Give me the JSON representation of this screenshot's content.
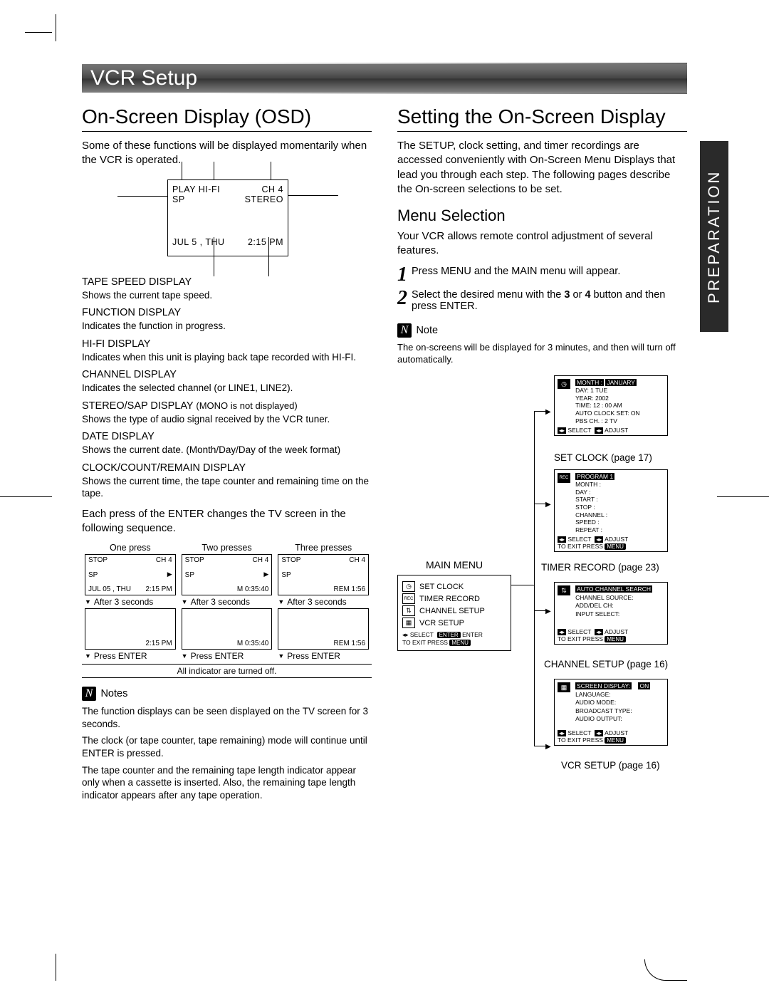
{
  "title": "VCR Setup",
  "side_tab": "PREPARATION",
  "left": {
    "section": "On-Screen Display (OSD)",
    "intro": "Some of these functions will be displayed momentarily when the VCR is operated.",
    "osd": {
      "l1_left": "PLAY HI-FI",
      "l1_right": "CH  4",
      "l2_left": "SP",
      "l2_right": "STEREO",
      "l3_left": "JUL   5 , THU",
      "l3_right": "2:15 PM"
    },
    "defs": [
      {
        "h": "TAPE SPEED DISPLAY",
        "p": "Shows the current tape speed."
      },
      {
        "h": "FUNCTION DISPLAY",
        "p": "Indicates the function in progress."
      },
      {
        "h": "HI-FI DISPLAY",
        "p": "Indicates when this unit is playing back tape recorded with HI-FI."
      },
      {
        "h": "CHANNEL DISPLAY",
        "p": "Indicates the selected channel (or LINE1, LINE2)."
      },
      {
        "h": "STEREO/SAP DISPLAY",
        "extra": "(MONO is not displayed)",
        "p": "Shows the type of audio signal received by the VCR tuner."
      },
      {
        "h": "DATE DISPLAY",
        "p": "Shows the current date. (Month/Day/Day of the week format)"
      },
      {
        "h": "CLOCK/COUNT/REMAIN DISPLAY",
        "p": "Shows the current time, the tape counter and remaining time on the tape."
      }
    ],
    "seq_intro": "Each press of the ENTER changes the TV screen in the following sequence.",
    "presses": [
      "One press",
      "Two presses",
      "Three presses"
    ],
    "tiny1": {
      "a": "STOP",
      "b": "CH   4",
      "c": "SP",
      "d": "JUL   05 , THU",
      "e": "2:15 PM",
      "f": "2:15 PM"
    },
    "tiny2": {
      "a": "STOP",
      "b": "CH   4",
      "c": "SP",
      "d": "",
      "e": "M 0:35:40",
      "f": "M 0:35:40"
    },
    "tiny3": {
      "a": "STOP",
      "b": "CH   4",
      "c": "SP",
      "d": "",
      "e": "REM 1:56",
      "f": "REM 1:56"
    },
    "after3": "After 3 seconds",
    "press_enter": "Press ENTER",
    "all_off": "All indicator are turned off.",
    "notes_label": "Notes",
    "notes": [
      "The function displays can be seen displayed on the TV screen for 3 seconds.",
      "The clock (or tape counter, tape remaining) mode will continue until ENTER is pressed.",
      "The tape counter and the remaining tape length indicator appear only when a cassette is inserted. Also, the remaining tape length indicator appears after any tape operation."
    ]
  },
  "right": {
    "section": "Setting the On-Screen Display",
    "intro": "The SETUP, clock setting, and timer recordings are accessed conveniently with On-Screen Menu Displays that lead you through each step. The following pages describe the On-screen selections to be set.",
    "subsection": "Menu Selection",
    "sub_intro": "Your VCR allows remote control adjustment of several features.",
    "step1": "Press MENU and the MAIN menu will appear.",
    "step2a": "Select the desired menu with the ",
    "step2b": "3",
    "step2c": " or ",
    "step2d": "4",
    "step2e": " button and then press ENTER.",
    "note_label": "Note",
    "note": "The on-screens will be displayed for 3 minutes, and then will turn off automatically.",
    "main_menu_label": "MAIN MENU",
    "main_items": [
      "SET  CLOCK",
      "TIMER RECORD",
      "CHANNEL  SETUP",
      "VCR SETUP"
    ],
    "mm_footer_select": "SELECT",
    "mm_footer_enter": "ENTER",
    "mm_footer_exit": "TO  EXIT   PRESS",
    "mm_footer_menu": "MENU",
    "sel_adj": {
      "select": "SELECT",
      "adjust": "ADJUST",
      "exit": "TO  EXIT   PRESS",
      "menu": "MENU"
    },
    "blocks": {
      "clock": {
        "rows": [
          [
            "MONTH :",
            "JANUARY"
          ],
          [
            "DAY",
            ":   1  TUE"
          ],
          [
            "YEAR",
            ":   2002"
          ],
          [
            "TIME",
            ":   12 : 00  AM"
          ],
          [
            "AUTO CLOCK SET:",
            "ON"
          ],
          [
            "PBS CH. :",
            "2  TV"
          ]
        ],
        "cap": "SET CLOCK (page 17)"
      },
      "timer": {
        "header": "PROGRAM  1",
        "rows": [
          "MONTH",
          "DAY",
          "START",
          "STOP",
          "CHANNEL",
          "SPEED",
          "REPEAT"
        ],
        "cap": "TIMER RECORD (page 23)"
      },
      "channel": {
        "hi": "AUTO  CHANNEL  SEARCH",
        "rows": [
          "CHANNEL  SOURCE:",
          "ADD/DEL CH:",
          "INPUT  SELECT:"
        ],
        "cap": "CHANNEL SETUP (page 16)"
      },
      "vcr": {
        "hi": "SCREEN  DISPLAY:",
        "hi_v": "ON",
        "rows": [
          "LANGUAGE:",
          "AUDIO MODE:",
          "BROADCAST  TYPE:",
          "AUDIO OUTPUT:"
        ],
        "cap": "VCR SETUP (page 16)"
      }
    }
  }
}
